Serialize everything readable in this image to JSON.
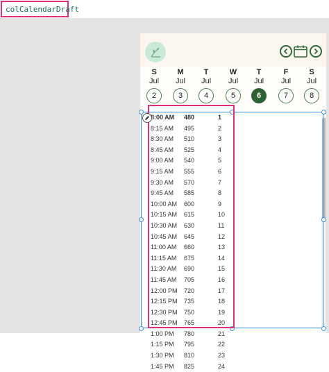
{
  "formula_bar": {
    "name_box": "colCalendarDraft"
  },
  "calendar": {
    "days": [
      {
        "dow": "S",
        "month": "Jul",
        "date": "2"
      },
      {
        "dow": "M",
        "month": "Jul",
        "date": "3"
      },
      {
        "dow": "T",
        "month": "Jul",
        "date": "4"
      },
      {
        "dow": "W",
        "month": "Jul",
        "date": "5"
      },
      {
        "dow": "T",
        "month": "Jul",
        "date": "6",
        "selected": true
      },
      {
        "dow": "F",
        "month": "Jul",
        "date": "7"
      },
      {
        "dow": "S",
        "month": "Jul",
        "date": "8"
      }
    ],
    "icons": {
      "prev": "chevron-left-icon",
      "calendar": "calendar-icon",
      "next": "chevron-right-icon",
      "logo": "plant-logo-icon"
    }
  },
  "gallery": {
    "rows": [
      {
        "time": "8:00 AM",
        "minutes": "480",
        "index": "1"
      },
      {
        "time": "8:15 AM",
        "minutes": "495",
        "index": "2"
      },
      {
        "time": "8:30 AM",
        "minutes": "510",
        "index": "3"
      },
      {
        "time": "8:45 AM",
        "minutes": "525",
        "index": "4"
      },
      {
        "time": "9:00 AM",
        "minutes": "540",
        "index": "5"
      },
      {
        "time": "9:15 AM",
        "minutes": "555",
        "index": "6"
      },
      {
        "time": "9:30 AM",
        "minutes": "570",
        "index": "7"
      },
      {
        "time": "9:45 AM",
        "minutes": "585",
        "index": "8"
      },
      {
        "time": "10:00 AM",
        "minutes": "600",
        "index": "9"
      },
      {
        "time": "10:15 AM",
        "minutes": "615",
        "index": "10"
      },
      {
        "time": "10:30 AM",
        "minutes": "630",
        "index": "11"
      },
      {
        "time": "10:45 AM",
        "minutes": "645",
        "index": "12"
      },
      {
        "time": "11:00 AM",
        "minutes": "660",
        "index": "13"
      },
      {
        "time": "11:15 AM",
        "minutes": "675",
        "index": "14"
      },
      {
        "time": "11:30 AM",
        "minutes": "690",
        "index": "15"
      },
      {
        "time": "11:45 AM",
        "minutes": "705",
        "index": "16"
      },
      {
        "time": "12:00 PM",
        "minutes": "720",
        "index": "17"
      },
      {
        "time": "12:15 PM",
        "minutes": "735",
        "index": "18"
      },
      {
        "time": "12:30 PM",
        "minutes": "750",
        "index": "19"
      },
      {
        "time": "12:45 PM",
        "minutes": "765",
        "index": "20"
      },
      {
        "time": "1:00 PM",
        "minutes": "780",
        "index": "21"
      },
      {
        "time": "1:15 PM",
        "minutes": "795",
        "index": "22"
      },
      {
        "time": "1:30 PM",
        "minutes": "810",
        "index": "23"
      },
      {
        "time": "1:45 PM",
        "minutes": "825",
        "index": "24"
      }
    ]
  },
  "colors": {
    "accent_pink": "#e0307a",
    "selection_blue": "#3b8fd9",
    "calendar_green": "#2e6133"
  }
}
